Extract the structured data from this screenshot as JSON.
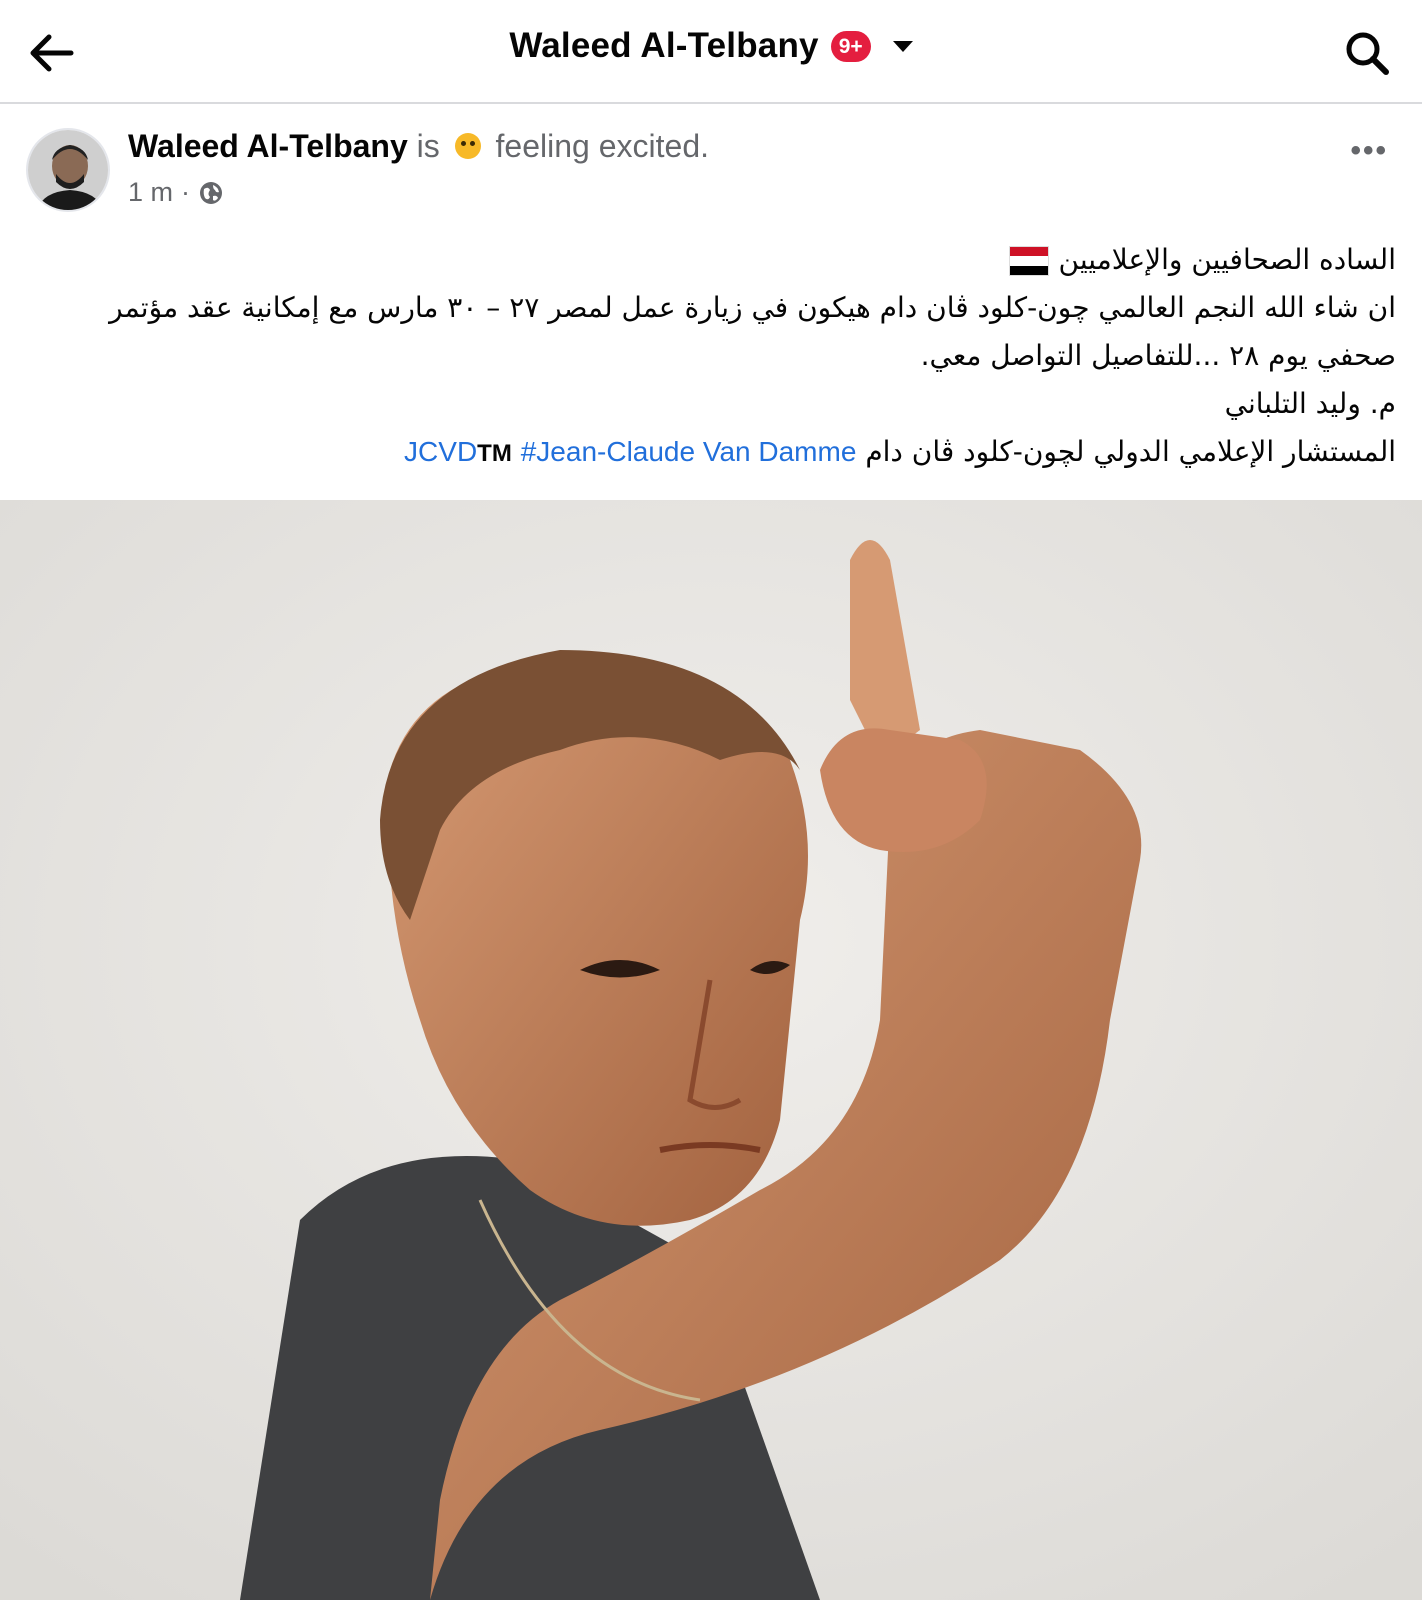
{
  "header": {
    "title": "Waleed Al-Telbany",
    "badge": "9+",
    "icons": {
      "back": "arrow-left-icon",
      "dropdown": "chevron-down-icon",
      "search": "search-icon"
    }
  },
  "post": {
    "author": "Waleed Al-Telbany",
    "is_label": "is",
    "feeling": "feeling excited.",
    "time": "1 m",
    "separator": "·",
    "privacy_icon": "globe-icon",
    "more_label": "•••",
    "body": {
      "line1": "الساده الصحافيين والإعلاميين",
      "line2": "ان شاء الله النجم العالمي چون-كلود ڤان دام هيكون في زيارة عمل لمصر ٢٧ – ٣٠ مارس مع إمكانية عقد مؤتمر",
      "line3": "صحفي يوم ٢٨ ...للتفاصيل التواصل معي.",
      "line4": "م. وليد التلباني",
      "line5_text": "المستشار الإعلامي الدولي لچون-كلود ڤان دام",
      "hashtag": "#Jean-Claude Van Damme",
      "tm": "TM",
      "page_link": "JCVD"
    },
    "flag": "egypt-flag"
  },
  "colors": {
    "link": "#216fdb",
    "badge": "#e41e3f",
    "secondary_text": "#65676b",
    "divider": "#d9dadd"
  }
}
